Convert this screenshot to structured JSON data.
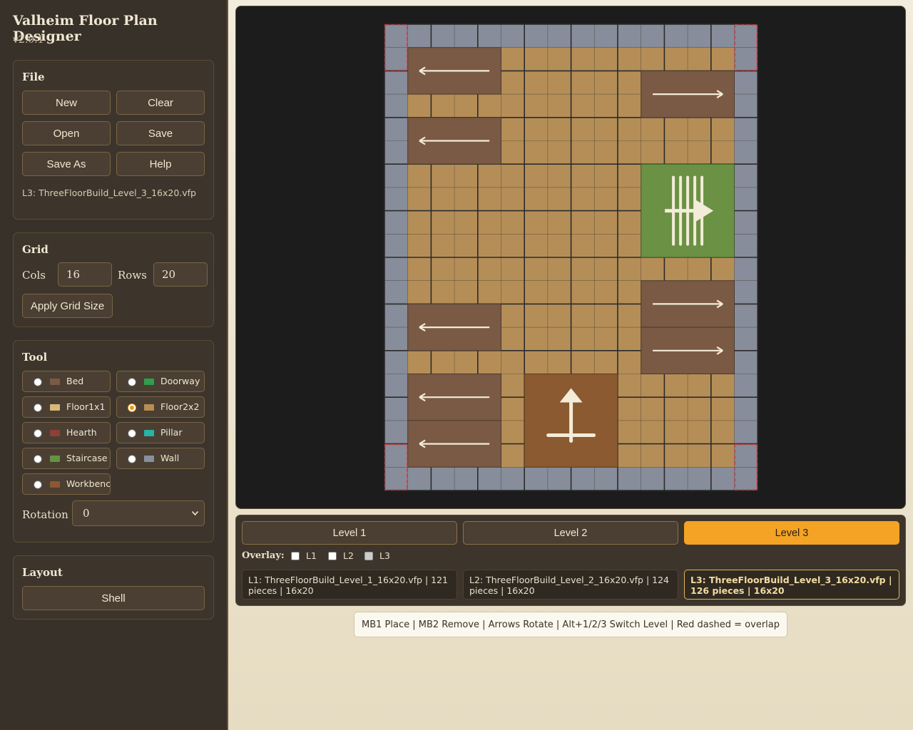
{
  "app": {
    "title": "Valheim Floor Plan Designer",
    "version": "v2.0.1"
  },
  "file": {
    "title": "File",
    "buttons": {
      "new": "New",
      "clear": "Clear",
      "open": "Open",
      "save": "Save",
      "save_as": "Save As",
      "help": "Help"
    },
    "current_path": "L3: ThreeFloorBuild_Level_3_16x20.vfp"
  },
  "grid": {
    "title": "Grid",
    "cols_label": "Cols",
    "cols_value": "16",
    "rows_label": "Rows",
    "rows_value": "20",
    "apply_label": "Apply Grid Size"
  },
  "tool": {
    "title": "Tool",
    "options": [
      {
        "label": "Bed",
        "color": "#7a5a45",
        "selected": false
      },
      {
        "label": "Doorway",
        "color": "#2f9e4f",
        "selected": false
      },
      {
        "label": "Floor1x1",
        "color": "#d8b77a",
        "selected": false
      },
      {
        "label": "Floor2x2",
        "color": "#b98d52",
        "selected": true
      },
      {
        "label": "Hearth",
        "color": "#8f3f35",
        "selected": false
      },
      {
        "label": "Pillar",
        "color": "#29b3a6",
        "selected": false
      },
      {
        "label": "Staircase",
        "color": "#64943f",
        "selected": false
      },
      {
        "label": "Wall",
        "color": "#8a8f9c",
        "selected": false
      },
      {
        "label": "Workbench",
        "color": "#8c5731",
        "selected": false
      }
    ],
    "rotation_label": "Rotation",
    "rotation_value": "0"
  },
  "layout": {
    "title": "Layout",
    "shell_label": "Shell"
  },
  "canvas": {
    "colors": {
      "background": "#1c1c1c",
      "floor": "#b58e57",
      "wall": "#878d9a",
      "bed": "#7a5a45",
      "staircase": "#6a9144",
      "workbench": "#8b5a30",
      "line": "#2b2b2b",
      "glyph": "#f3ecd8",
      "overlap": "#e0414a"
    }
  },
  "levels": {
    "tabs": [
      "Level 1",
      "Level 2",
      "Level 3"
    ],
    "active_index": 2,
    "overlay_label": "Overlay:",
    "overlay_options": [
      {
        "label": "L1",
        "checked": false,
        "disabled": false
      },
      {
        "label": "L2",
        "checked": false,
        "disabled": false
      },
      {
        "label": "L3",
        "checked": false,
        "disabled": true
      }
    ],
    "info": [
      "L1: ThreeFloorBuild_Level_1_16x20.vfp | 121 pieces | 16x20",
      "L2: ThreeFloorBuild_Level_2_16x20.vfp | 124 pieces | 16x20",
      "L3: ThreeFloorBuild_Level_3_16x20.vfp | 126 pieces | 16x20"
    ]
  },
  "hint": "MB1 Place | MB2 Remove | Arrows Rotate | Alt+1/2/3 Switch Level | Red dashed = overlap"
}
